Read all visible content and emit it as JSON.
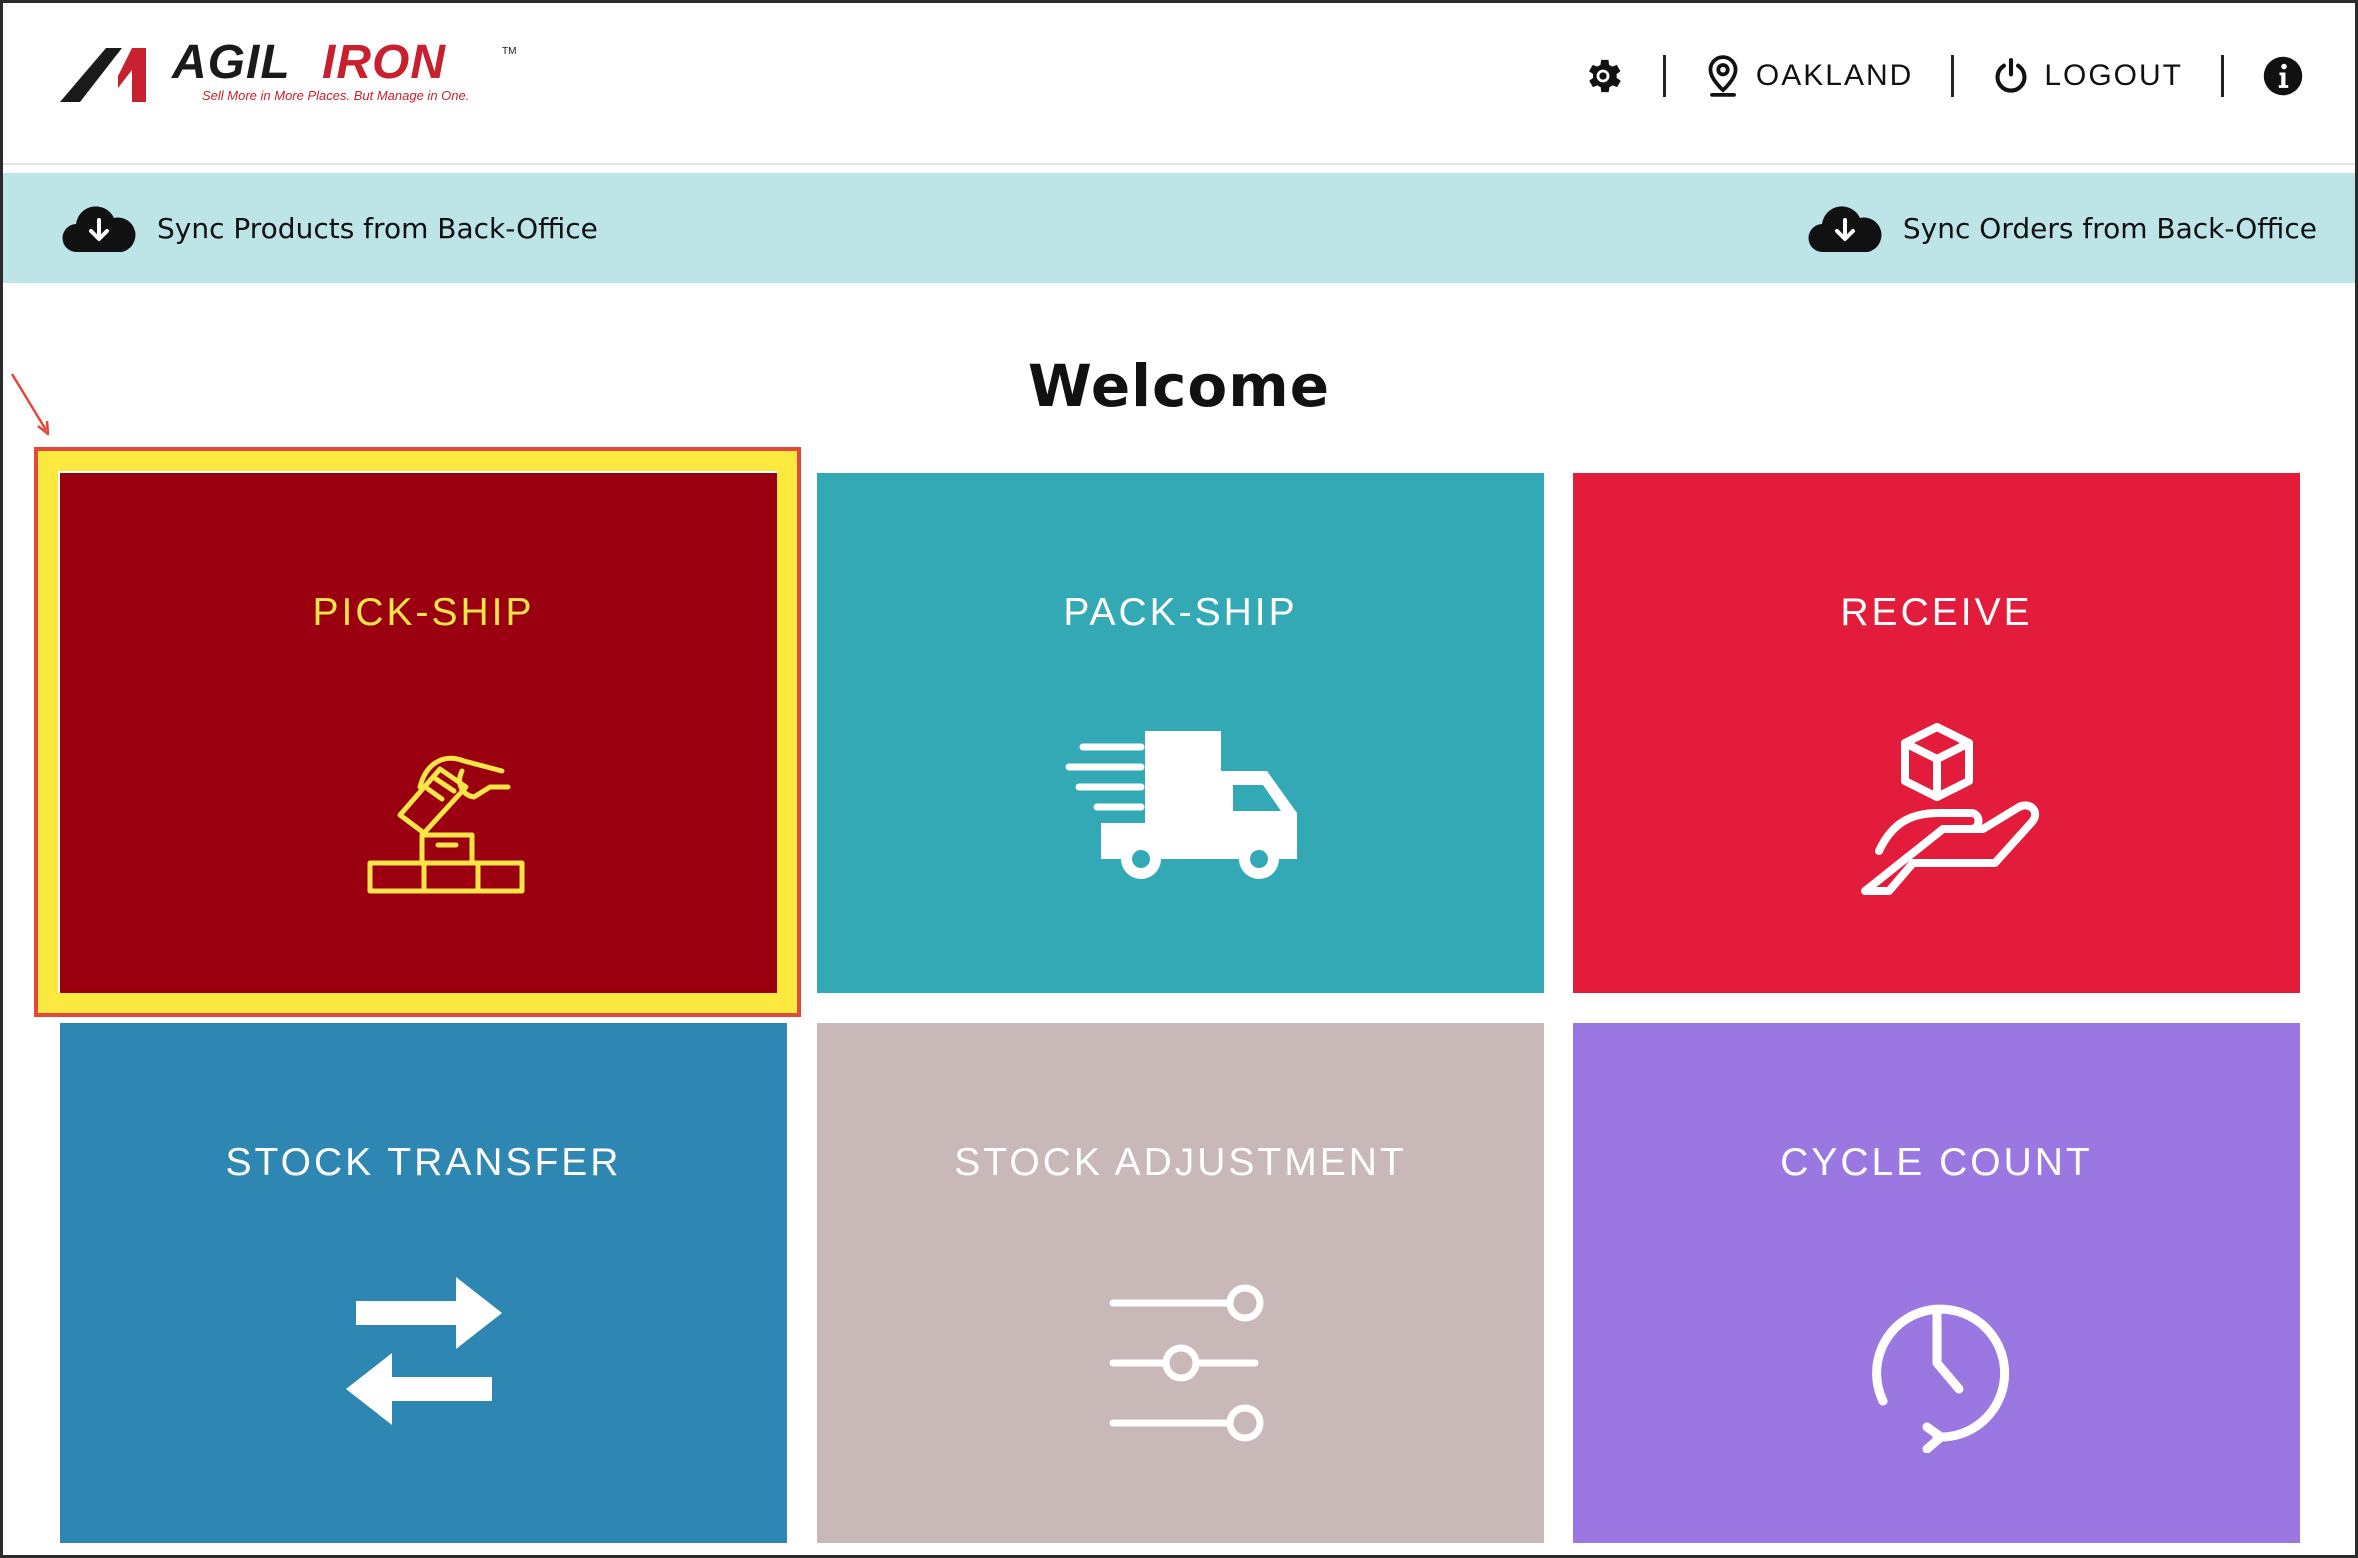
{
  "header": {
    "location_label": "OAKLAND",
    "logout_label": "LOGOUT"
  },
  "sync": {
    "products_label": "Sync Products from Back-Office",
    "orders_label": "Sync Orders from Back-Office"
  },
  "main": {
    "welcome": "Welcome",
    "tiles": [
      {
        "label": "PICK-SHIP",
        "icon": "hand-pick-boxes-icon",
        "color": "#9b0010",
        "highlighted": true
      },
      {
        "label": "PACK-SHIP",
        "icon": "delivery-truck-icon",
        "color": "#33a9b5"
      },
      {
        "label": "RECEIVE",
        "icon": "hand-box-icon",
        "color": "#e21c3a"
      },
      {
        "label": "STOCK TRANSFER",
        "icon": "transfer-arrows-icon",
        "color": "#2e87b3"
      },
      {
        "label": "STOCK ADJUSTMENT",
        "icon": "sliders-icon",
        "color": "#c9b8b8"
      },
      {
        "label": "CYCLE COUNT",
        "icon": "clock-history-icon",
        "color": "#9b78e1"
      }
    ]
  },
  "colors": {
    "sync_bar": "#bde4e6",
    "highlight": "#fbe93f",
    "highlight_text": "#f9e547",
    "brand_red": "#c8202f"
  }
}
